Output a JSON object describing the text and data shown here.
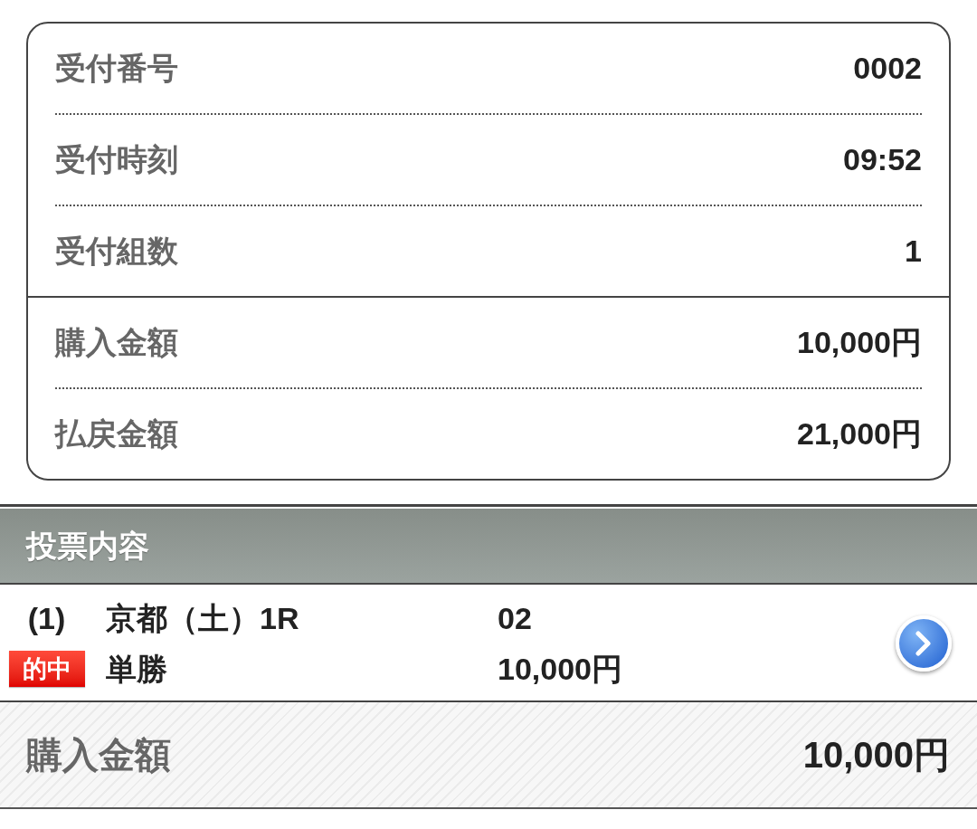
{
  "summary": {
    "sections": [
      {
        "rows": [
          {
            "label": "受付番号",
            "value": "0002"
          },
          {
            "label": "受付時刻",
            "value": "09:52"
          },
          {
            "label": "受付組数",
            "value": "1"
          }
        ]
      },
      {
        "rows": [
          {
            "label": "購入金額",
            "value": "10,000円"
          },
          {
            "label": "払戻金額",
            "value": "21,000円"
          }
        ]
      }
    ]
  },
  "vote_content": {
    "title": "投票内容",
    "bets": [
      {
        "number": "(1)",
        "race": "京都（土）1R",
        "horse": "02",
        "hit": true,
        "hit_label": "的中",
        "bet_type": "単勝",
        "amount": "10,000円"
      }
    ]
  },
  "total": {
    "label": "購入金額",
    "value": "10,000円"
  }
}
